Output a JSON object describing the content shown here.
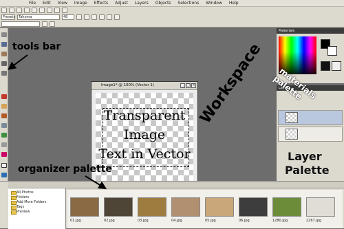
{
  "menubar": {
    "items": [
      "File",
      "Edit",
      "View",
      "Image",
      "Effects",
      "Adjust",
      "Layers",
      "Objects",
      "Selections",
      "Window",
      "Help"
    ]
  },
  "toolbar": {
    "font_name": "Tahoma",
    "font_size": "48",
    "tool_label": "Presets"
  },
  "document": {
    "title": "Image1* @ 100% (Vector 1)",
    "lines": [
      "Transparent",
      "Image",
      "Text in Vector"
    ]
  },
  "panels": {
    "materials_head": "Materials",
    "layers_head": "Layers"
  },
  "organizer": {
    "folders": [
      "All Photos",
      "Folders",
      "Add More Folders",
      "Tags",
      "Preview"
    ],
    "photos": [
      {
        "label": "01.jpg",
        "color": "#8a6a44"
      },
      {
        "label": "02.jpg",
        "color": "#4f4536"
      },
      {
        "label": "03.jpg",
        "color": "#9e7b3f"
      },
      {
        "label": "04.jpg",
        "color": "#b09070"
      },
      {
        "label": "05.jpg",
        "color": "#c9a77a"
      },
      {
        "label": "06.jpg",
        "color": "#3d3d3d"
      },
      {
        "label": "1280.jpg",
        "color": "#6c8c3a"
      },
      {
        "label": "2267.jpg",
        "color": "#e0dcd6"
      }
    ]
  },
  "annotations": {
    "tools_bar": "tools bar",
    "workspace": "Workspace",
    "materials_palette": "materials palette",
    "layer_palette_1": "Layer",
    "layer_palette_2": "Palette",
    "organizer_palette": "organizer palette"
  },
  "colors": {
    "workspace_bg": "#6d6d6d",
    "chrome": "#dcd9cf",
    "arrow": "#000000"
  }
}
